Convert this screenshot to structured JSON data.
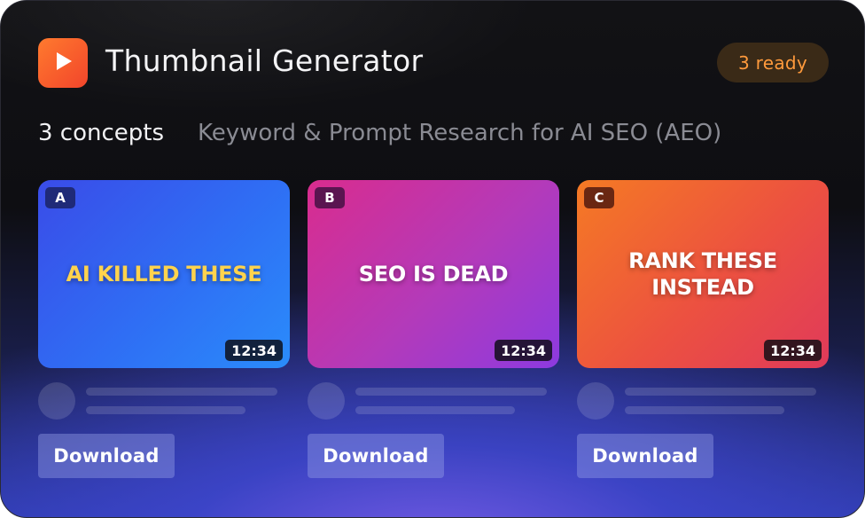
{
  "header": {
    "title": "Thumbnail Generator",
    "logo_icon": "play-icon",
    "status_badge": "3 ready"
  },
  "subheader": {
    "count": "3 concepts",
    "topic": "Keyword & Prompt Research for AI SEO (AEO)"
  },
  "thumbnails": [
    {
      "letter": "A",
      "headline": "AI KILLED THESE",
      "duration": "12:34",
      "download_label": "Download"
    },
    {
      "letter": "B",
      "headline": "SEO IS DEAD",
      "duration": "12:34",
      "download_label": "Download"
    },
    {
      "letter": "C",
      "headline": "RANK THESE INSTEAD",
      "duration": "12:34",
      "download_label": "Download"
    }
  ],
  "colors": {
    "accent_orange": "#f2452b",
    "badge_text": "#ff9a3c",
    "headline_yellow": "#ffd34d"
  }
}
